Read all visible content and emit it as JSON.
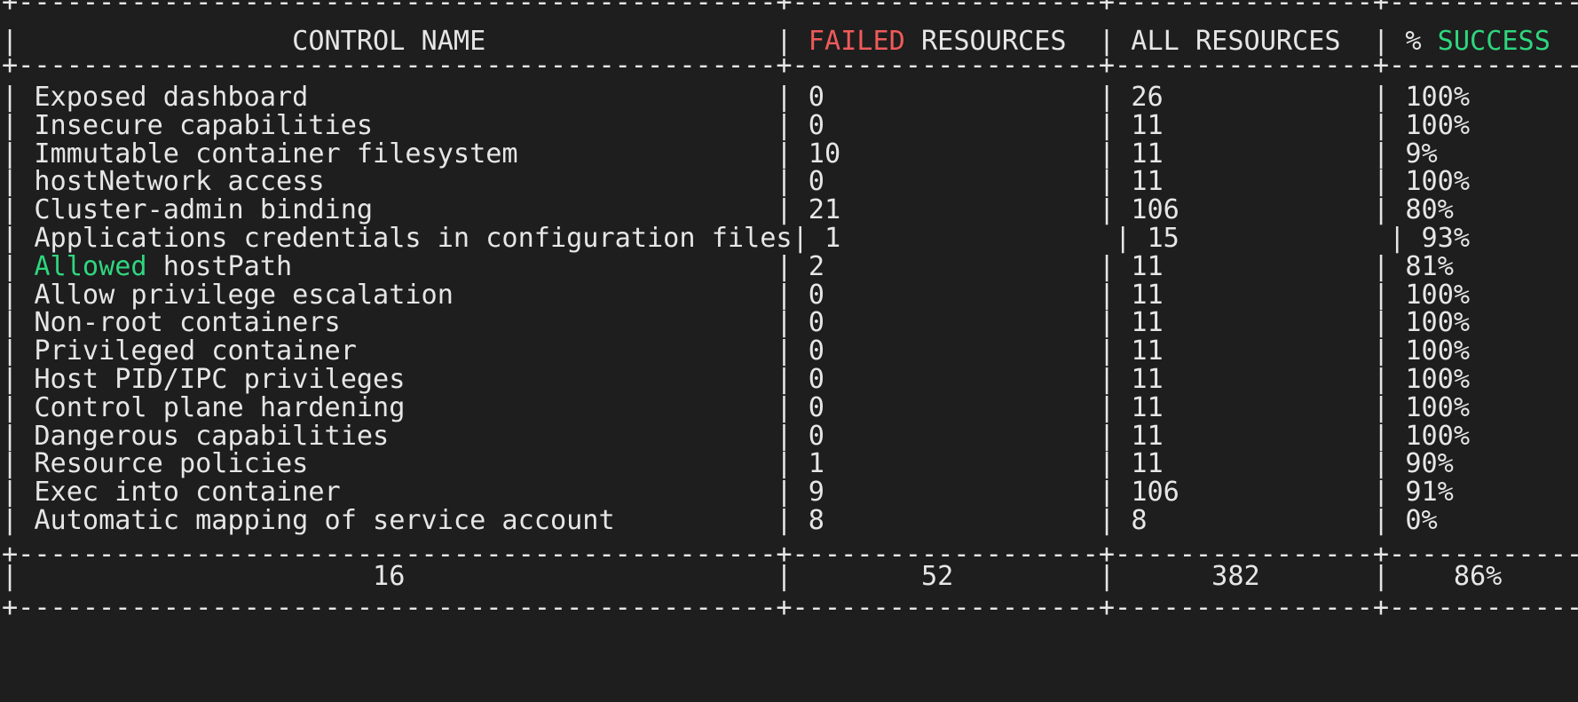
{
  "terminal": {
    "colors": {
      "background": "#1e1e1e",
      "text": "#e6e6e6",
      "failed_highlight": "#f05a5a",
      "success_highlight": "#2fd67e"
    },
    "border_line": "+-----------------------------------------------+-------------------+----------------+------------+",
    "header": {
      "control_name": "CONTROL NAME",
      "failed_word": "FAILED",
      "failed_rest": " RESOURCES",
      "all_resources": "ALL RESOURCES",
      "pct_prefix": "% ",
      "success_word": "SUCCESS"
    },
    "rows": [
      {
        "name": "Exposed dashboard",
        "failed": "0",
        "all": "26",
        "pct": "100%"
      },
      {
        "name": "Insecure capabilities",
        "failed": "0",
        "all": "11",
        "pct": "100%"
      },
      {
        "name": "Immutable container filesystem",
        "failed": "10",
        "all": "11",
        "pct": "9%"
      },
      {
        "name": "hostNetwork access",
        "failed": "0",
        "all": "11",
        "pct": "100%"
      },
      {
        "name": "Cluster-admin binding",
        "failed": "21",
        "all": "106",
        "pct": "80%"
      },
      {
        "name": "Applications credentials in configuration files",
        "failed": "1",
        "all": "15",
        "pct": "93%"
      },
      {
        "name": "hostPath",
        "highlight_prefix": "Allowed",
        "failed": "2",
        "all": "11",
        "pct": "81%"
      },
      {
        "name": "Allow privilege escalation",
        "failed": "0",
        "all": "11",
        "pct": "100%"
      },
      {
        "name": "Non-root containers",
        "failed": "0",
        "all": "11",
        "pct": "100%"
      },
      {
        "name": "Privileged container",
        "failed": "0",
        "all": "11",
        "pct": "100%"
      },
      {
        "name": "Host PID/IPC privileges",
        "failed": "0",
        "all": "11",
        "pct": "100%"
      },
      {
        "name": "Control plane hardening",
        "failed": "0",
        "all": "11",
        "pct": "100%"
      },
      {
        "name": "Dangerous capabilities",
        "failed": "0",
        "all": "11",
        "pct": "100%"
      },
      {
        "name": "Resource policies",
        "failed": "1",
        "all": "11",
        "pct": "90%"
      },
      {
        "name": "Exec into container",
        "failed": "9",
        "all": "106",
        "pct": "91%"
      },
      {
        "name": "Automatic mapping of service account",
        "failed": "8",
        "all": "8",
        "pct": "0%"
      }
    ],
    "totals": {
      "controls": "16",
      "failed": "52",
      "all": "382",
      "pct": "86%"
    }
  }
}
